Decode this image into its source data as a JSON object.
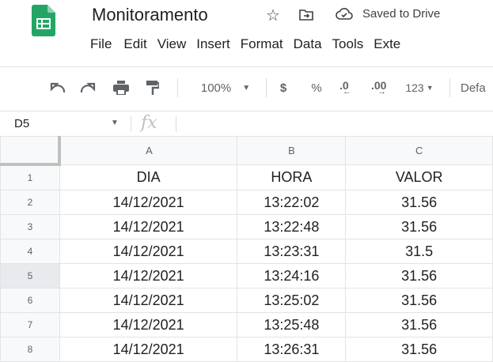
{
  "app": {
    "title": "Monitoramento",
    "saved_status": "Saved to Drive",
    "menu": [
      "File",
      "Edit",
      "View",
      "Insert",
      "Format",
      "Data",
      "Tools",
      "Exte"
    ]
  },
  "toolbar": {
    "zoom": "100%",
    "currency": "$",
    "percent": "%",
    "decrease_decimal": ".0",
    "increase_decimal": ".00",
    "more_formats": "123",
    "font": "Defa"
  },
  "formula_bar": {
    "cell_ref": "D5",
    "fx_label": "fx"
  },
  "sheet": {
    "columns": [
      "A",
      "B",
      "C"
    ],
    "selected_row": 5,
    "rows": [
      {
        "n": "1",
        "cells": [
          "DIA",
          "HORA",
          "VALOR"
        ]
      },
      {
        "n": "2",
        "cells": [
          "14/12/2021",
          "13:22:02",
          "31.56"
        ]
      },
      {
        "n": "3",
        "cells": [
          "14/12/2021",
          "13:22:48",
          "31.56"
        ]
      },
      {
        "n": "4",
        "cells": [
          "14/12/2021",
          "13:23:31",
          "31.5"
        ]
      },
      {
        "n": "5",
        "cells": [
          "14/12/2021",
          "13:24:16",
          "31.56"
        ]
      },
      {
        "n": "6",
        "cells": [
          "14/12/2021",
          "13:25:02",
          "31.56"
        ]
      },
      {
        "n": "7",
        "cells": [
          "14/12/2021",
          "13:25:48",
          "31.56"
        ]
      },
      {
        "n": "8",
        "cells": [
          "14/12/2021",
          "13:26:31",
          "31.56"
        ]
      }
    ]
  },
  "colors": {
    "brand_green": "#23a566",
    "header_bg": "#f8f9fa",
    "gridline": "#e2e3e3",
    "icon_gray": "#5f6368"
  }
}
